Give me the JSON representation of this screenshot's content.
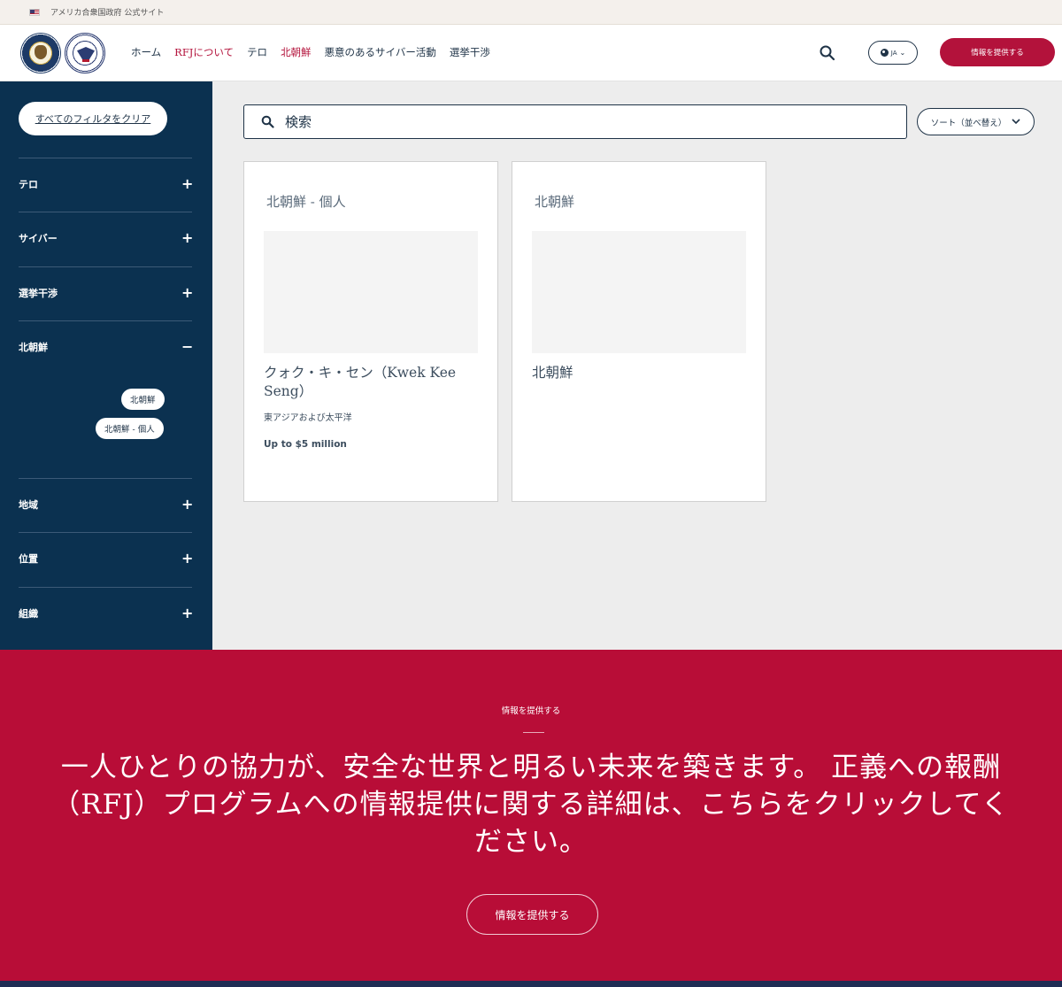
{
  "gov_banner": {
    "text": "アメリカ合衆国政府 公式サイト"
  },
  "header": {
    "nav": [
      {
        "label": "ホーム",
        "active": false
      },
      {
        "label": "RFJについて",
        "active": true
      },
      {
        "label": "テロ",
        "active": false
      },
      {
        "label": "北朝鮮",
        "active": true
      },
      {
        "label": "悪意のあるサイバー活動",
        "active": false
      },
      {
        "label": "選挙干渉",
        "active": false
      }
    ],
    "language": "JA",
    "cta_label": "情報を提供する"
  },
  "sidebar": {
    "clear_label": "すべてのフィルタをクリア",
    "facets": [
      {
        "label": "テロ",
        "toggle": "+"
      },
      {
        "label": "サイバー",
        "toggle": "+"
      },
      {
        "label": "選挙干渉",
        "toggle": "+"
      },
      {
        "label": "北朝鮮",
        "toggle": "−"
      },
      {
        "label": "地域",
        "toggle": "+"
      },
      {
        "label": "位置",
        "toggle": "+"
      },
      {
        "label": "組織",
        "toggle": "+"
      }
    ],
    "selected_chips": [
      "北朝鮮",
      "北朝鮮 - 個人"
    ]
  },
  "search": {
    "placeholder": "検索",
    "value": ""
  },
  "sort": {
    "label": "ソート（並べ替え）"
  },
  "cards": [
    {
      "tag": "北朝鮮 - 個人",
      "name": "クォク・キ・セン（Kwek Kee Seng）",
      "region": "東アジアおよび太平洋",
      "reward": "Up to $5 million"
    },
    {
      "tag": "北朝鮮",
      "name": "北朝鮮",
      "region": "",
      "reward": ""
    }
  ],
  "footer": {
    "kicker": "情報を提供する",
    "headline": "一人ひとりの協力が、安全な世界と明るい未来を築きます。 正義への報酬（RFJ）プログラムへの情報提供に関する詳細は、こちらをクリックしてください。",
    "button_label": "情報を提供する"
  },
  "colors": {
    "navy": "#0b3150",
    "crimson": "#b80d37",
    "accent": "#b3123b"
  }
}
